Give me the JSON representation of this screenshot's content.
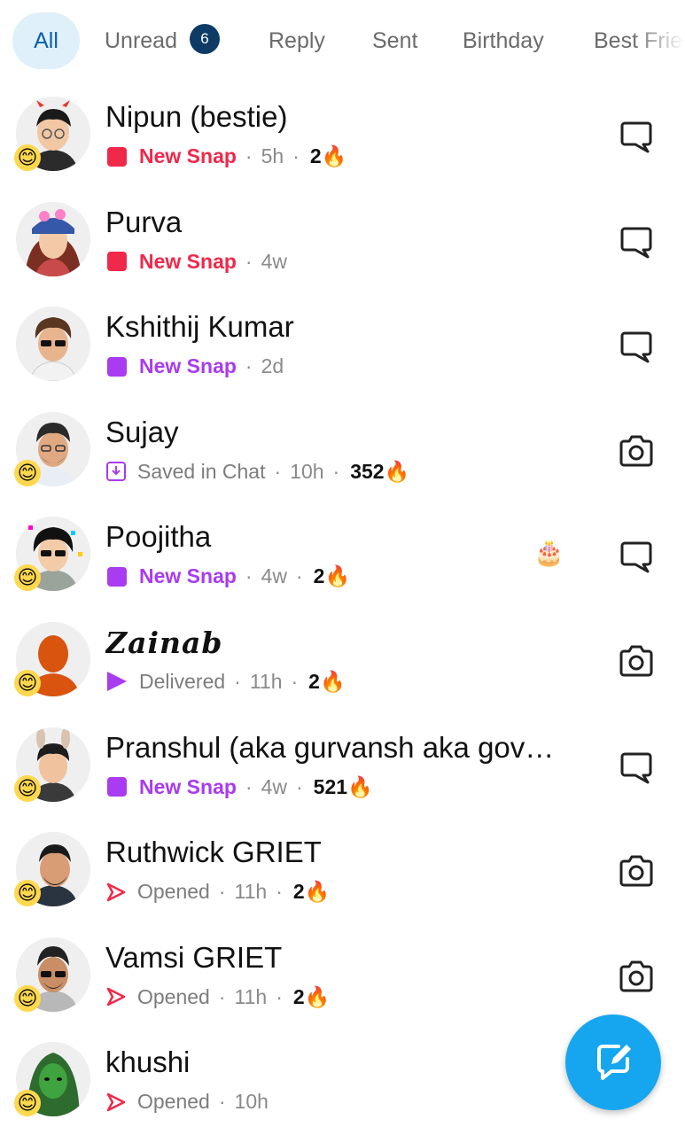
{
  "tabs": {
    "all": "All",
    "unread": "Unread",
    "unread_count": "6",
    "reply": "Reply",
    "sent": "Sent",
    "birthday": "Birthday",
    "best_friends": "Best Frie"
  },
  "chats": [
    {
      "name": "Nipun (bestie)",
      "status": "New Snap",
      "time": "5h",
      "streak": "2",
      "action_icon": "chat-bubble-icon"
    },
    {
      "name": "Purva",
      "status": "New Snap",
      "time": "4w",
      "streak": "",
      "action_icon": "chat-bubble-icon"
    },
    {
      "name": "Kshithij Kumar",
      "status": "New Snap",
      "time": "2d",
      "streak": "",
      "action_icon": "chat-bubble-icon"
    },
    {
      "name": "Sujay",
      "status": "Saved in Chat",
      "time": "10h",
      "streak": "352",
      "action_icon": "camera-icon"
    },
    {
      "name": "Poojitha",
      "status": "New Snap",
      "time": "4w",
      "streak": "2",
      "action_icon": "chat-bubble-icon",
      "badge": "🎂"
    },
    {
      "name": "Zainab",
      "status": "Delivered",
      "time": "11h",
      "streak": "2",
      "action_icon": "camera-icon"
    },
    {
      "name": "Pranshul (aka gurvansh aka gov…",
      "status": "New Snap",
      "time": "4w",
      "streak": "521",
      "action_icon": "chat-bubble-icon"
    },
    {
      "name": "Ruthwick GRIET",
      "status": "Opened",
      "time": "11h",
      "streak": "2",
      "action_icon": "camera-icon"
    },
    {
      "name": "Vamsi GRIET",
      "status": "Opened",
      "time": "11h",
      "streak": "2",
      "action_icon": "camera-icon"
    },
    {
      "name": "khushi",
      "status": "Opened",
      "time": "10h",
      "streak": "",
      "action_icon": "camera-icon"
    }
  ],
  "icons": {
    "streak": "🔥",
    "friend_emoji": "😊"
  },
  "colors": {
    "new_snap_red": "#f0284a",
    "new_snap_purple": "#a93bf0",
    "accent_blue": "#16a6ef"
  }
}
